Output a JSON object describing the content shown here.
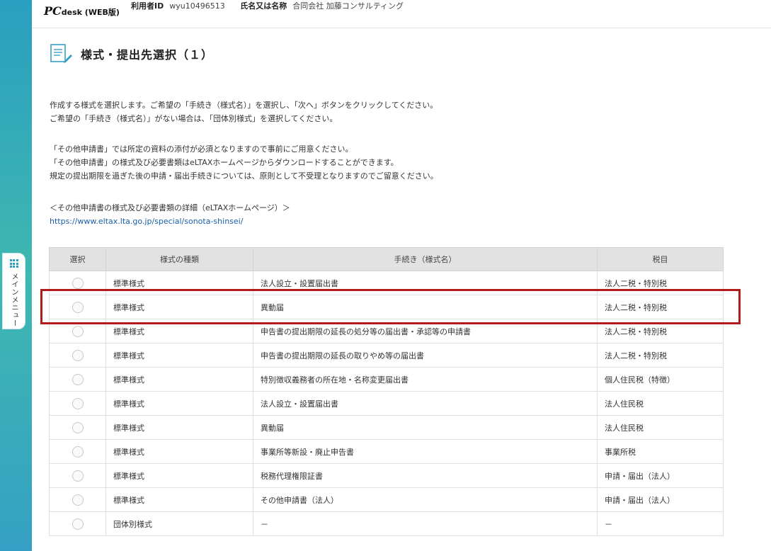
{
  "side_menu": {
    "label": "メインメニュー",
    "icon": "grid-icon"
  },
  "header": {
    "logo_main": "PC",
    "logo_sub": "desk (WEB版)",
    "user_id_label": "利用者ID",
    "user_id": "wyu10496513",
    "name_label": "氏名又は名称",
    "name": "合同会社 加藤コンサルティング"
  },
  "page": {
    "title": "様式・提出先選択（１）",
    "title_icon": "document-edit-icon"
  },
  "description": {
    "line1": "作成する様式を選択します。ご希望の「手続き（様式名）」を選択し、「次へ」ボタンをクリックしてください。",
    "line2": "ご希望の「手続き（様式名）」がない場合は、「団体別様式」を選択してください。",
    "line3": "「その他申請書」では所定の資料の添付が必須となりますので事前にご用意ください。",
    "line4": "「その他申請書」の様式及び必要書類はeLTAXホームページからダウンロードすることができます。",
    "line5": "規定の提出期限を過ぎた後の申請・届出手続きについては、原則として不受理となりますのでご留意ください。",
    "link_caption": "＜その他申請書の様式及び必要書類の詳細（eLTAXホームページ）＞",
    "link_url": "https://www.eltax.lta.go.jp/special/sonota-shinsei/"
  },
  "table": {
    "headers": [
      "選択",
      "様式の種類",
      "手続き（様式名）",
      "税目"
    ],
    "rows": [
      {
        "type": "標準様式",
        "name": "法人設立・設置届出書",
        "tax": "法人二税・特別税"
      },
      {
        "type": "標準様式",
        "name": "異動届",
        "tax": "法人二税・特別税"
      },
      {
        "type": "標準様式",
        "name": "申告書の提出期限の延長の処分等の届出書・承認等の申請書",
        "tax": "法人二税・特別税"
      },
      {
        "type": "標準様式",
        "name": "申告書の提出期限の延長の取りやめ等の届出書",
        "tax": "法人二税・特別税"
      },
      {
        "type": "標準様式",
        "name": "特別徴収義務者の所在地・名称変更届出書",
        "tax": "個人住民税（特徴）"
      },
      {
        "type": "標準様式",
        "name": "法人設立・設置届出書",
        "tax": "法人住民税"
      },
      {
        "type": "標準様式",
        "name": "異動届",
        "tax": "法人住民税"
      },
      {
        "type": "標準様式",
        "name": "事業所等新設・廃止申告書",
        "tax": "事業所税"
      },
      {
        "type": "標準様式",
        "name": "税務代理権限証書",
        "tax": "申請・届出（法人）"
      },
      {
        "type": "標準様式",
        "name": "その他申請書（法人）",
        "tax": "申請・届出（法人）"
      },
      {
        "type": "団体別様式",
        "name": "－",
        "tax": "－"
      }
    ]
  },
  "colors": {
    "highlight": "#b01c1c",
    "rail": "#2a9fc0",
    "link": "#1a5fa8"
  }
}
